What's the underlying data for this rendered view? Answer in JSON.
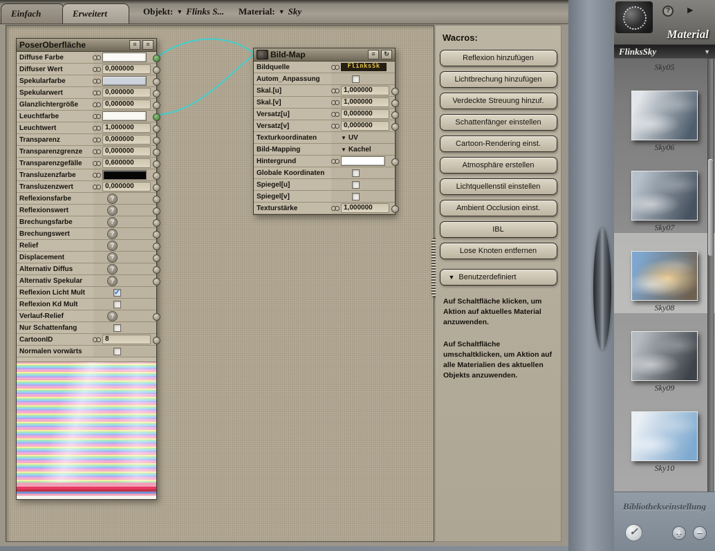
{
  "ui": {
    "dropdown_arrow": "▼",
    "check_glyph": "✓",
    "question_glyph": "?",
    "menu_icon": "≡",
    "cycle_icon": "↻",
    "wire_color": "#3bd2d2"
  },
  "header": {
    "tabs": [
      {
        "label": "Einfach"
      },
      {
        "label": "Erweitert"
      }
    ],
    "object_label": "Objekt:",
    "object_value": "Flinks S...",
    "material_label": "Material:",
    "material_value": "Sky"
  },
  "surface_node": {
    "title": "PoserOberfläche",
    "rows": [
      {
        "label": "Diffuse Farbe",
        "kind": "color",
        "swatch": "#fbfaf6",
        "plug": true,
        "connected": true
      },
      {
        "label": "Diffuser Wert",
        "kind": "value",
        "value": "0,000000",
        "plug": true
      },
      {
        "label": "Spekularfarbe",
        "kind": "color",
        "swatch": "#cdd3dc",
        "plug": true
      },
      {
        "label": "Spekularwert",
        "kind": "value",
        "value": "0,000000",
        "plug": true
      },
      {
        "label": "Glanzlichtergröße",
        "kind": "value",
        "value": "0,000000",
        "plug": true
      },
      {
        "label": "Leuchtfarbe",
        "kind": "color",
        "swatch": "#f9f8f3",
        "plug": true,
        "connected": true
      },
      {
        "label": "Leuchtwert",
        "kind": "value",
        "value": "1,000000",
        "plug": true
      },
      {
        "label": "Transparenz",
        "kind": "value",
        "value": "0,000000",
        "plug": true
      },
      {
        "label": "Transparenzgrenze",
        "kind": "value",
        "value": "0,000000",
        "plug": true
      },
      {
        "label": "Transparenzgefälle",
        "kind": "value",
        "value": "0,600000",
        "plug": true
      },
      {
        "label": "Transluzenzfarbe",
        "kind": "color",
        "swatch": "#060606",
        "plug": true
      },
      {
        "label": "Transluzenzwert",
        "kind": "value",
        "value": "0,000000",
        "plug": true
      },
      {
        "label": "Reflexionsfarbe",
        "kind": "question",
        "plug": true
      },
      {
        "label": "Reflexionswert",
        "kind": "question",
        "plug": true
      },
      {
        "label": "Brechungsfarbe",
        "kind": "question",
        "plug": true
      },
      {
        "label": "Brechungswert",
        "kind": "question",
        "plug": true
      },
      {
        "label": "Relief",
        "kind": "question",
        "plug": true
      },
      {
        "label": "Displacement",
        "kind": "question",
        "plug": true
      },
      {
        "label": "Alternativ Diffus",
        "kind": "question",
        "plug": true
      },
      {
        "label": "Alternativ Spekular",
        "kind": "question",
        "plug": true
      },
      {
        "label": "Reflexion Licht Mult",
        "kind": "checkbox",
        "checked": true
      },
      {
        "label": "Reflexion Kd Mult",
        "kind": "checkbox",
        "checked": false
      },
      {
        "label": "Verlauf-Relief",
        "kind": "question",
        "plug": true
      },
      {
        "label": "Nur Schattenfang",
        "kind": "checkbox",
        "checked": false
      },
      {
        "label": "CartoonID",
        "kind": "value",
        "value": "8",
        "plug": true
      },
      {
        "label": "Normalen vorwärts",
        "kind": "checkbox",
        "checked": false
      }
    ]
  },
  "image_map_node": {
    "title": "Bild-Map",
    "rows": [
      {
        "label": "Bildquelle",
        "kind": "source",
        "value": "FlinksSk"
      },
      {
        "label": "Autom_Anpassung",
        "kind": "checkbox",
        "checked": false
      },
      {
        "label": "Skal.[u]",
        "kind": "value",
        "value": "1,000000",
        "plug": true
      },
      {
        "label": "Skal.[v]",
        "kind": "value",
        "value": "1,000000",
        "plug": true
      },
      {
        "label": "Versatz[u]",
        "kind": "value",
        "value": "0,000000",
        "plug": true
      },
      {
        "label": "Versatz[v]",
        "kind": "value",
        "value": "0,000000",
        "plug": true
      },
      {
        "label": "Texturkoordinaten",
        "kind": "dropdown",
        "value": "UV"
      },
      {
        "label": "Bild-Mapping",
        "kind": "dropdown",
        "value": "Kachel"
      },
      {
        "label": "Hintergrund",
        "kind": "color",
        "swatch": "#ffffff",
        "plug": true
      },
      {
        "label": "Globale Koordinaten",
        "kind": "checkbox",
        "checked": false
      },
      {
        "label": "Spiegel[u]",
        "kind": "checkbox",
        "checked": false
      },
      {
        "label": "Spiegel[v]",
        "kind": "checkbox",
        "checked": false
      },
      {
        "label": "Texturstärke",
        "kind": "value",
        "value": "1,000000",
        "plug": true
      }
    ]
  },
  "wacros": {
    "title": "Wacros:",
    "buttons": [
      {
        "label": "Reflexion hinzufügen"
      },
      {
        "label": "Lichtbrechung hinzufügen"
      },
      {
        "label": "Verdeckte Streuung hinzuf."
      },
      {
        "label": "Schattenfänger einstellen"
      },
      {
        "label": "Cartoon-Rendering einst."
      },
      {
        "label": "Atmosphäre erstellen"
      },
      {
        "label": "Lichtquellenstil einstellen"
      },
      {
        "label": "Ambient Occlusion einst."
      },
      {
        "label": "IBL"
      },
      {
        "label": "Lose Knoten entfernen"
      }
    ],
    "custom_button": "Benutzerdefiniert",
    "note1": "Auf Schaltfläche klicken, um Aktion auf aktuelles Material anzuwenden.",
    "note2": "Auf Schaltfläche umschaltklicken, um Aktion auf alle Materialien des aktuellen Objekts anzuwenden."
  },
  "library": {
    "title": "Material",
    "help_icon": "?",
    "flyout_icon": "▶",
    "category": "FlinksSky",
    "items": [
      {
        "name": "Sky05",
        "label_only": true
      },
      {
        "name": "Sky06",
        "c1": "#e2e6ea",
        "c2": "#4f5e6d"
      },
      {
        "name": "Sky07",
        "c1": "#b6c0ca",
        "c2": "#46525f"
      },
      {
        "name": "Sky08",
        "c1": "#7ea6ce",
        "c2": "#6d6152",
        "glow": "#e9c98f",
        "selected": true
      },
      {
        "name": "Sky09",
        "c1": "#b4bac0",
        "c2": "#3e4349"
      },
      {
        "name": "Sky10",
        "c1": "#e9eff5",
        "c2": "#7fa9cf"
      },
      {
        "name": "",
        "c1": "#3f7ec2",
        "c2": "#9cc4e8",
        "partial": true
      }
    ],
    "footer": "Bibliothekseinstellung",
    "buttons": {
      "apply": "✓",
      "add": "+",
      "remove": "−"
    }
  }
}
